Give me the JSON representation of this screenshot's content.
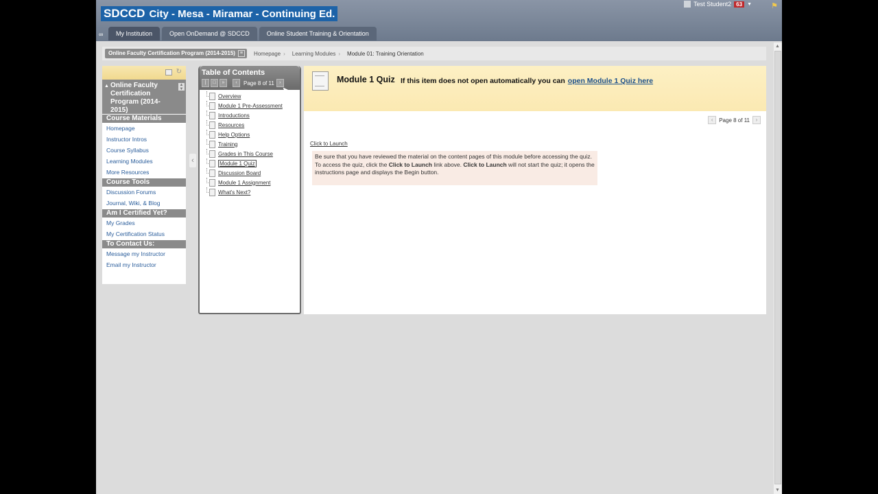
{
  "header": {
    "logo_abbr": "SDCCD",
    "logo_text": "City - Mesa - Miramar - Continuing Ed.",
    "user_name": "Test Student2",
    "notification_count": "63",
    "tabs": [
      {
        "label": "My Institution"
      },
      {
        "label": "Open OnDemand @ SDCCD"
      },
      {
        "label": "Online Student Training & Orientation"
      }
    ]
  },
  "breadcrumb": {
    "course": "Online Faculty Certification Program (2014-2015)",
    "items": [
      "Homepage",
      "Learning Modules",
      "Module 01: Training Orientation"
    ]
  },
  "menu": {
    "course_title": "Online Faculty Certification Program (2014-2015)",
    "sections": [
      {
        "title": "Course Materials",
        "items": [
          "Homepage",
          "Instructor Intros",
          "Course Syllabus",
          "Learning Modules",
          "More Resources"
        ]
      },
      {
        "title": "Course Tools",
        "items": [
          "Discussion Forums",
          "Journal, Wiki, & Blog"
        ]
      },
      {
        "title": "Am I Certified Yet?",
        "items": [
          "My Grades",
          "My Certification Status"
        ]
      },
      {
        "title": "To Contact Us:",
        "items": [
          "Message my Instructor",
          "Email my Instructor"
        ]
      }
    ]
  },
  "toc": {
    "title": "Table of Contents",
    "page_label": "Page 8 of 11",
    "items": [
      "Overview",
      "Module 1 Pre-Assessment",
      "Introductions",
      "Resources",
      "Help Options",
      "Training",
      "Grades in This Course",
      "Module 1 Quiz",
      "Discussion Board",
      "Module 1 Assignment",
      "What's Next?"
    ],
    "selected_index": 7
  },
  "content": {
    "title": "Module 1 Quiz",
    "message": "If this item does not open automatically you can",
    "link_text": "open Module 1 Quiz here",
    "page_label": "Page 8 of 11",
    "launch_text": "Click to Launch",
    "note_1": "Be sure that you have reviewed the material on the content pages of this module before accessing the quiz.  To access the quiz, click the ",
    "note_bold_1": "Click to Launch",
    "note_2": " link above.  ",
    "note_bold_2": "Click to Launch",
    "note_3": " will not start the quiz; it opens the instructions page and displays the Begin button."
  },
  "colors": {
    "header_bg": "#7b8698",
    "logo_bg": "#1d63a8",
    "menu_link": "#2a5d9b",
    "content_head_bg": "#fcecbb",
    "note_bg": "#f9ebe4"
  }
}
